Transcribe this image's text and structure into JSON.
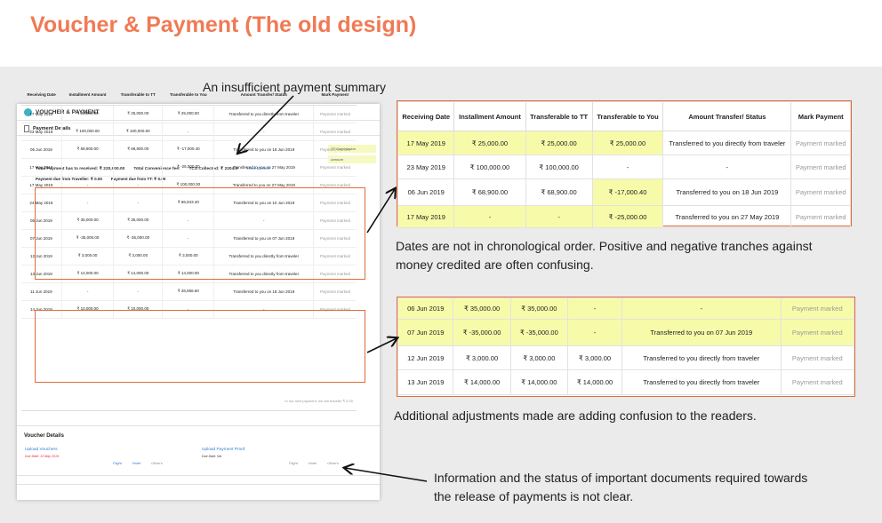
{
  "title": "Voucher & Payment (The old design)",
  "annotations": {
    "summary": "An insufficient payment summary",
    "dates": [
      "Dates are not in chronological order. Positive and negative tranches against",
      "money credited are often confusing."
    ],
    "adjustments": "Additional adjustments made are adding confusion to the readers.",
    "documents": [
      "Information and the status of important documents required towards",
      "the release of payments is not clear."
    ]
  },
  "panel": {
    "header": "VOUCHER & PAYMENT",
    "sub_header": "Payment Details",
    "tt_commission": "TT Commission",
    "amount": "Amount",
    "total_received": "Total Payment has to received: ₹ 220,900.00",
    "total_convenience": "Total Convenience fee:",
    "tcs_collected": "TCS Collected: ₹ 2204.0",
    "view_invoice": "View Invoice",
    "due_traveller": "Payment due from Traveller: ₹ 0.00",
    "due_tt": "Payment due from TT: ₹ 0.00",
    "columns": [
      "Receiving Date",
      "Installment Amount",
      "Transferable to TT",
      "Transferable to You",
      "Amount Transfer/ Status",
      "Mark Payment"
    ],
    "rows": [
      [
        "17 May 2019",
        "₹ 25,000.00",
        "₹ 25,000.00",
        "₹ 25,000.00",
        "Transferred to you directly from traveler",
        "Payment marked"
      ],
      [
        "23 May 2019",
        "₹ 100,000.00",
        "₹ 100,000.00",
        "-",
        "-",
        "Payment marked"
      ],
      [
        "06 Jun 2019",
        "₹ 68,900.00",
        "₹ 68,900.00",
        "₹ -17,000.40",
        "Transferred to you on 18 Jun 2019",
        "Payment marked"
      ],
      [
        "17 May 2019",
        "-",
        "-",
        "₹ -25,000.00",
        "Transferred to you on 27 May 2019",
        "Payment marked"
      ],
      [
        "17 May 2019",
        "-",
        "-",
        "₹ 100,000.00",
        "Transferred to you on 27 May 2019",
        "Payment marked"
      ],
      [
        "24 May 2019",
        "-",
        "-",
        "₹ 86,843.40",
        "Transferred to you on 10 Jun 2019",
        "Payment marked"
      ],
      [
        "06 Jun 2019",
        "₹ 35,000.00",
        "₹ 35,000.00",
        "-",
        "-",
        "Payment marked"
      ],
      [
        "07 Jun 2019",
        "₹ -35,000.00",
        "₹ -35,000.00",
        "-",
        "Transferred to you on 07 Jun 2019",
        "Payment marked"
      ],
      [
        "12 Jun 2019",
        "₹ 3,000.00",
        "₹ 3,000.00",
        "₹ 3,000.00",
        "Transferred to you directly from traveler",
        "Payment marked"
      ],
      [
        "13 Jun 2019",
        "₹ 14,000.00",
        "₹ 14,000.00",
        "₹ 14,000.00",
        "Transferred to you directly from traveler",
        "Payment marked"
      ],
      [
        "11 Jun 2019",
        "-",
        "-",
        "₹ 26,656.60",
        "Transferred to you on 18 Jun 2019",
        "Payment marked"
      ],
      [
        "14 Jun 2019",
        "₹ 10,000.00",
        "₹ 10,000.00",
        "-",
        "-",
        "Payment marked"
      ]
    ],
    "footer_note": "In our next payment, we will transfer ₹ 0.00",
    "voucher_details": "Voucher Details",
    "upload_vouchers": "Upload Vouchers",
    "upload_vouchers_due": "Due Date: 13 May 2019",
    "upload_payment_proof": "Upload Payment Proof",
    "upload_payment_due": "Due Date: NA",
    "chips": [
      "Flight",
      "Hotel",
      "Other's"
    ]
  },
  "zoom1": {
    "columns": [
      "Receiving Date",
      "Installment Amount",
      "Transferable to TT",
      "Transferable to You",
      "Amount Transfer/ Status",
      "Mark Payment"
    ],
    "rows": [
      [
        "17 May 2019",
        "₹ 25,000.00",
        "₹ 25,000.00",
        "₹ 25,000.00",
        "Transferred to you directly from traveler",
        "Payment marked"
      ],
      [
        "23 May 2019",
        "₹ 100,000.00",
        "₹ 100,000.00",
        "-",
        "-",
        "Payment marked"
      ],
      [
        "06 Jun 2019",
        "₹ 68,900.00",
        "₹ 68,900.00",
        "₹ -17,000.40",
        "Transferred to you on 18 Jun 2019",
        "Payment marked"
      ],
      [
        "17 May 2019",
        "-",
        "-",
        "₹ -25,000.00",
        "Transferred to you on 27 May 2019",
        "Payment marked"
      ]
    ]
  },
  "zoom2": {
    "rows": [
      [
        "06 Jun 2019",
        "₹ 35,000.00",
        "₹ 35,000.00",
        "-",
        "-",
        "Payment marked"
      ],
      [
        "07 Jun 2019",
        "₹ -35,000.00",
        "₹ -35,000.00",
        "-",
        "Transferred to you on 07 Jun 2019",
        "Payment marked"
      ],
      [
        "12 Jun 2019",
        "₹ 3,000.00",
        "₹ 3,000.00",
        "₹ 3,000.00",
        "Transferred to you directly from traveler",
        "Payment marked"
      ],
      [
        "13 Jun 2019",
        "₹ 14,000.00",
        "₹ 14,000.00",
        "₹ 14,000.00",
        "Transferred to you directly from traveler",
        "Payment marked"
      ]
    ]
  },
  "colors": {
    "accent": "#f07a55",
    "outline": "#e06c3c",
    "highlight": "#f7fba9",
    "link": "#2e7bd6"
  }
}
